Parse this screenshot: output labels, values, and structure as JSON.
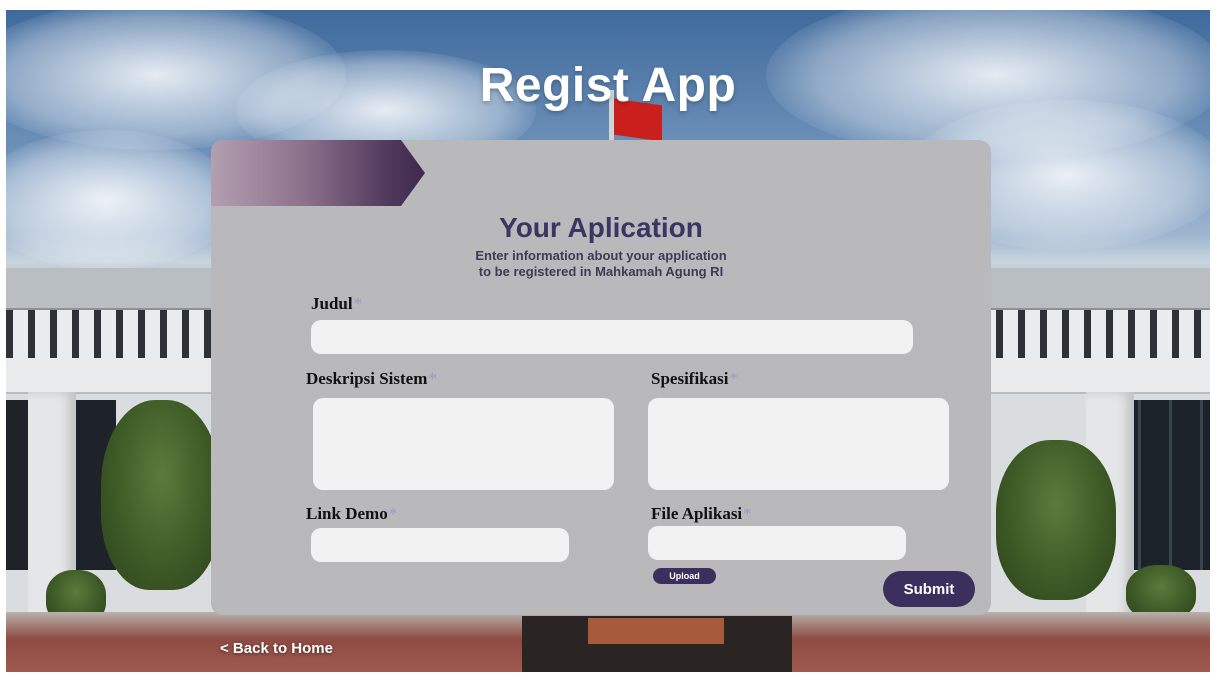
{
  "app": {
    "title": "Regist App"
  },
  "form": {
    "heading": "Your Aplication",
    "subtitle_line1": "Enter information about your application",
    "subtitle_line2": "to be registered in Mahkamah Agung RI",
    "required_mark": "*",
    "fields": {
      "judul": {
        "label": "Judul",
        "value": ""
      },
      "deskripsi": {
        "label": "Deskripsi Sistem",
        "value": ""
      },
      "spesifikasi": {
        "label": "Spesifikasi",
        "value": ""
      },
      "link_demo": {
        "label": "Link Demo",
        "value": ""
      },
      "file_aplikasi": {
        "label": "File Aplikasi",
        "value": ""
      }
    },
    "upload_label": "Upload",
    "submit_label": "Submit"
  },
  "nav": {
    "back_label": "< Back to Home"
  },
  "colors": {
    "card_bg": "#b9b9bb",
    "accent": "#3b2f5e",
    "heading": "#3b3563",
    "required": "#9d97c9",
    "field_bg": "#f2f2f3"
  }
}
